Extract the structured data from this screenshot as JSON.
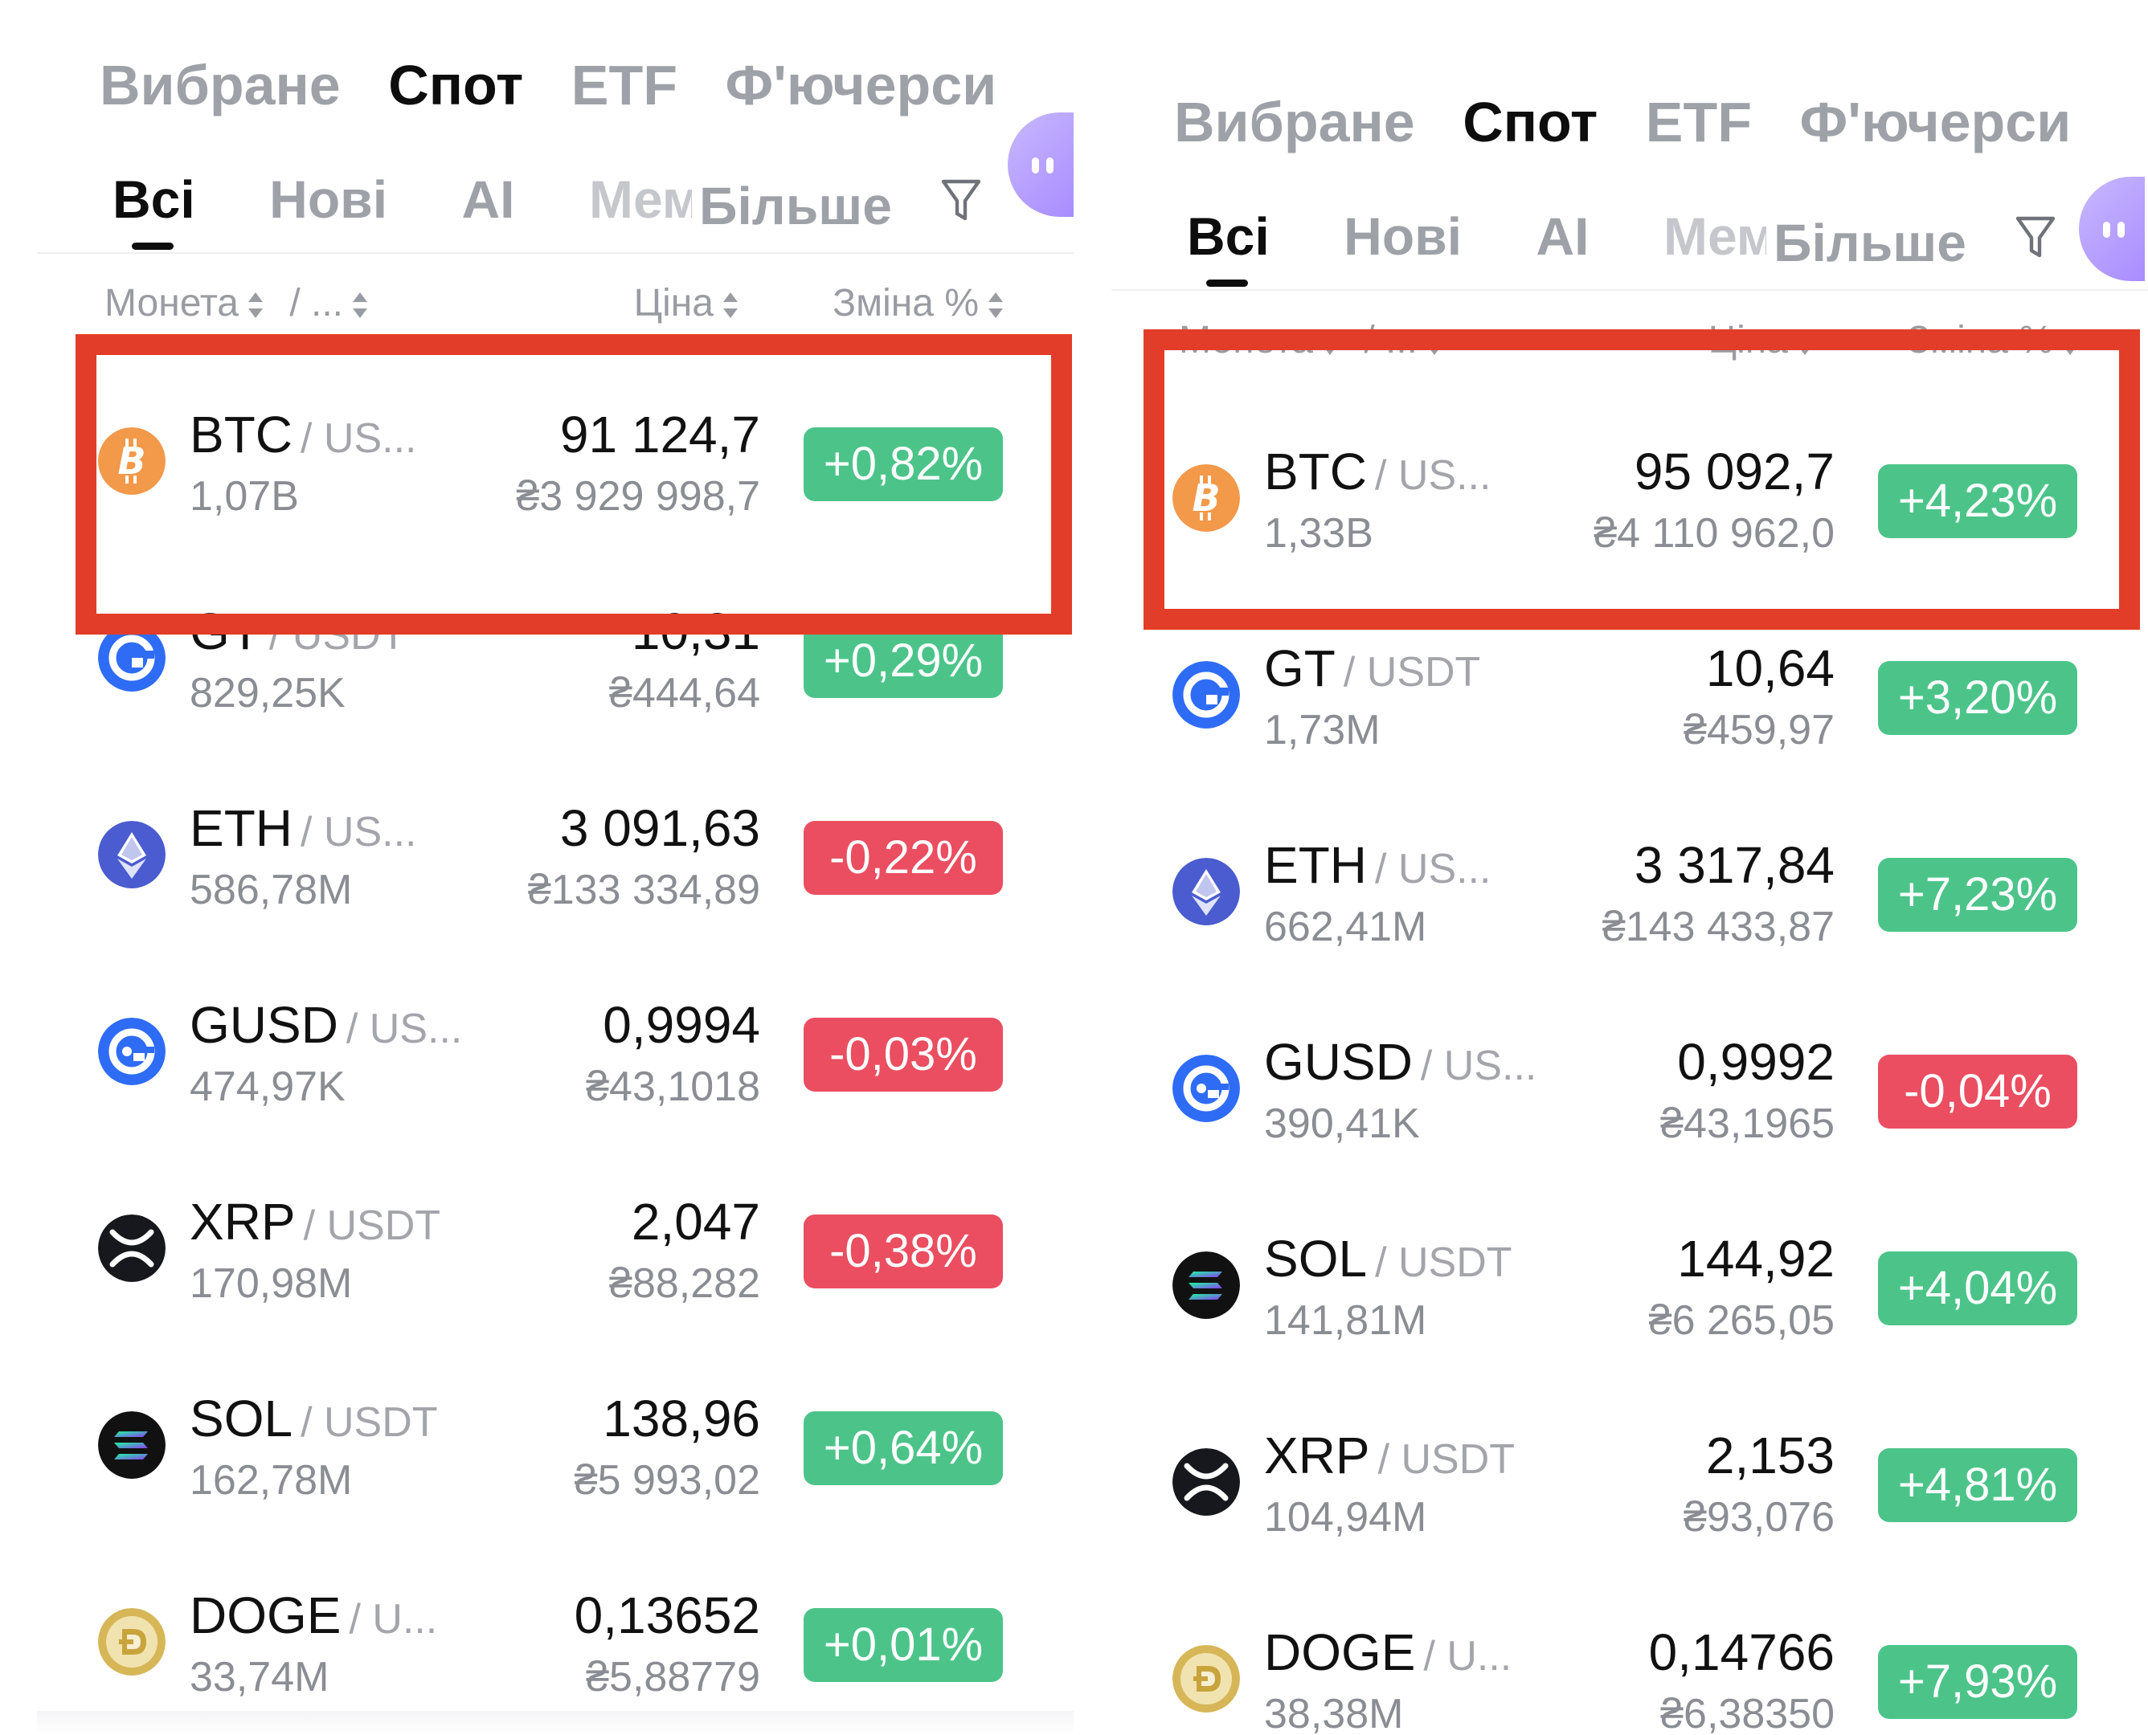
{
  "colors": {
    "up": "#4cc489",
    "down": "#ea4e60",
    "highlight": "#e23d28",
    "active_text": "#0d0d0d",
    "muted_text": "#9ea1a8"
  },
  "left": {
    "tabs_primary": [
      "Вибране",
      "Спот",
      "ETF",
      "Ф'ючерси"
    ],
    "tabs_secondary": [
      "Всі",
      "Нові",
      "AI",
      "Мем"
    ],
    "more": "Більше",
    "header": {
      "coin": "Монета",
      "sep": "/ ...",
      "price": "Ціна",
      "change": "Зміна %"
    },
    "rows": [
      {
        "symbol": "BTC",
        "quote": "/ US...",
        "volume": "1,07B",
        "price": "91 124,7",
        "fiat": "₴3 929 998,7",
        "change": "+0,82%",
        "dir": "up",
        "icon": "btc-icon"
      },
      {
        "symbol": "GT",
        "quote": "/ USDT",
        "volume": "829,25K",
        "price": "10,31",
        "fiat": "₴444,64",
        "change": "+0,29%",
        "dir": "up",
        "icon": "gt-icon"
      },
      {
        "symbol": "ETH",
        "quote": "/ US...",
        "volume": "586,78M",
        "price": "3 091,63",
        "fiat": "₴133 334,89",
        "change": "-0,22%",
        "dir": "down",
        "icon": "eth-icon"
      },
      {
        "symbol": "GUSD",
        "quote": "/ US...",
        "volume": "474,97K",
        "price": "0,9994",
        "fiat": "₴43,1018",
        "change": "-0,03%",
        "dir": "down",
        "icon": "gusd-icon"
      },
      {
        "symbol": "XRP",
        "quote": "/ USDT",
        "volume": "170,98M",
        "price": "2,047",
        "fiat": "₴88,282",
        "change": "-0,38%",
        "dir": "down",
        "icon": "xrp-icon"
      },
      {
        "symbol": "SOL",
        "quote": "/ USDT",
        "volume": "162,78M",
        "price": "138,96",
        "fiat": "₴5 993,02",
        "change": "+0,64%",
        "dir": "up",
        "icon": "sol-icon"
      },
      {
        "symbol": "DOGE",
        "quote": "/ U...",
        "volume": "33,74M",
        "price": "0,13652",
        "fiat": "₴5,88779",
        "change": "+0,01%",
        "dir": "up",
        "icon": "doge-icon"
      }
    ]
  },
  "right": {
    "tabs_primary": [
      "Вибране",
      "Спот",
      "ETF",
      "Ф'ючерси"
    ],
    "tabs_secondary": [
      "Всі",
      "Нові",
      "AI",
      "Мем"
    ],
    "more": "Більше",
    "header": {
      "coin": "Монета",
      "sep": "/ ...",
      "price": "Ціна",
      "change": "Зміна %"
    },
    "rows": [
      {
        "symbol": "BTC",
        "quote": "/ US...",
        "volume": "1,33B",
        "price": "95 092,7",
        "fiat": "₴4 110 962,0",
        "change": "+4,23%",
        "dir": "up",
        "icon": "btc-icon"
      },
      {
        "symbol": "GT",
        "quote": "/ USDT",
        "volume": "1,73M",
        "price": "10,64",
        "fiat": "₴459,97",
        "change": "+3,20%",
        "dir": "up",
        "icon": "gt-icon"
      },
      {
        "symbol": "ETH",
        "quote": "/ US...",
        "volume": "662,41M",
        "price": "3 317,84",
        "fiat": "₴143 433,87",
        "change": "+7,23%",
        "dir": "up",
        "icon": "eth-icon"
      },
      {
        "symbol": "GUSD",
        "quote": "/ US...",
        "volume": "390,41K",
        "price": "0,9992",
        "fiat": "₴43,1965",
        "change": "-0,04%",
        "dir": "down",
        "icon": "gusd-icon"
      },
      {
        "symbol": "SOL",
        "quote": "/ USDT",
        "volume": "141,81M",
        "price": "144,92",
        "fiat": "₴6 265,05",
        "change": "+4,04%",
        "dir": "up",
        "icon": "sol-icon"
      },
      {
        "symbol": "XRP",
        "quote": "/ USDT",
        "volume": "104,94M",
        "price": "2,153",
        "fiat": "₴93,076",
        "change": "+4,81%",
        "dir": "up",
        "icon": "xrp-icon"
      },
      {
        "symbol": "DOGE",
        "quote": "/ U...",
        "volume": "38,38M",
        "price": "0,14766",
        "fiat": "₴6,38350",
        "change": "+7,93%",
        "dir": "up",
        "icon": "doge-icon"
      }
    ]
  }
}
